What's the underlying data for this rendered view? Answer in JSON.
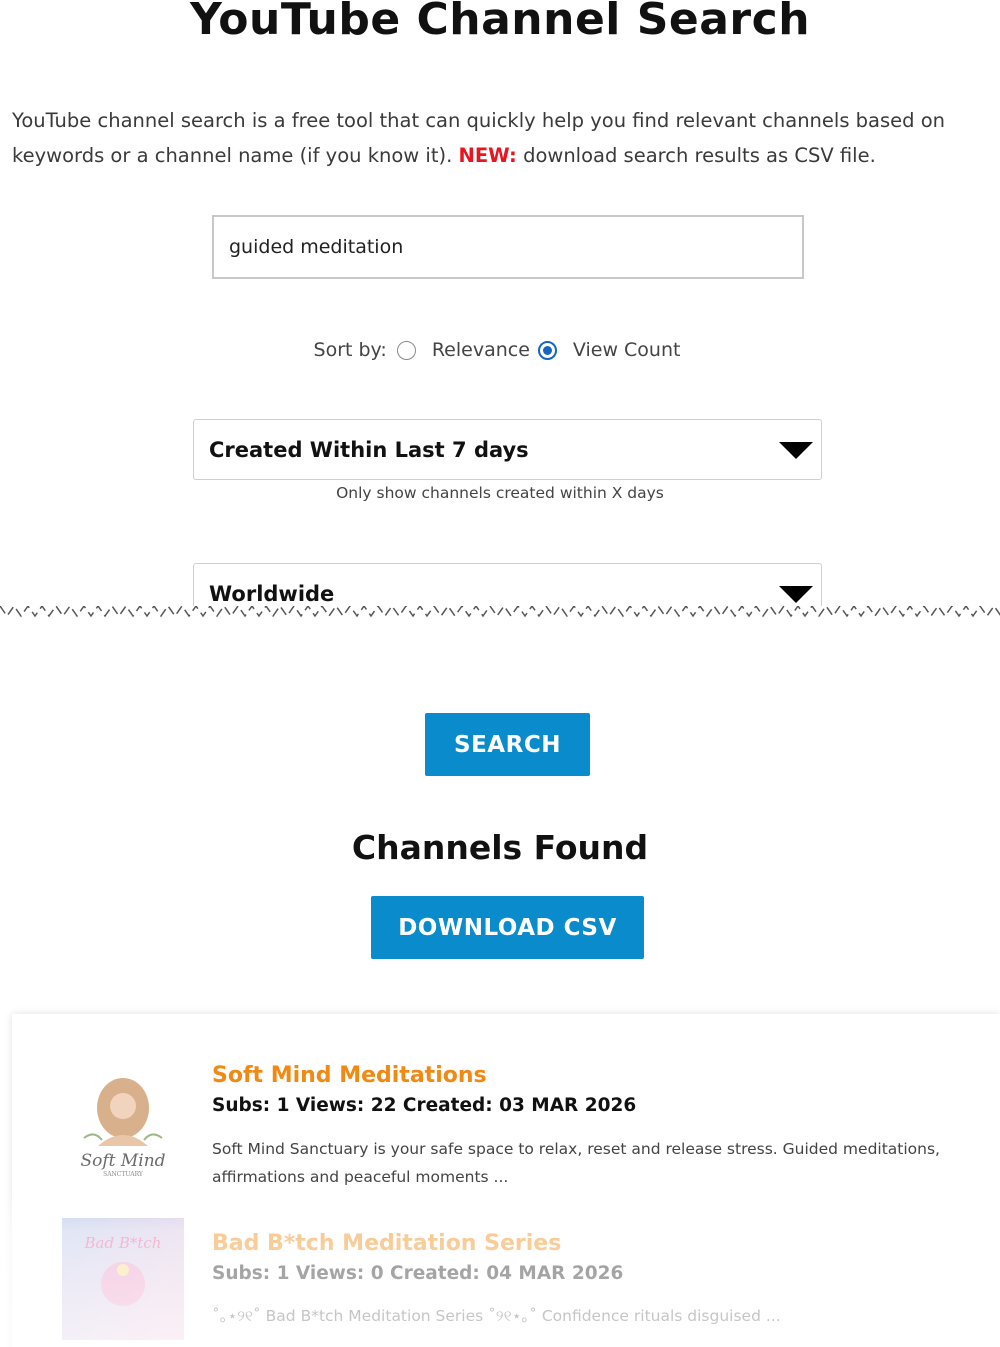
{
  "page": {
    "title": "YouTube Channel Search",
    "intro_text": "YouTube channel search is a free tool that can quickly help you find relevant channels based on keywords or a channel name (if you know it).",
    "intro_new_label": "NEW:",
    "intro_new_text": "download search results as CSV file."
  },
  "search": {
    "value": "guided meditation"
  },
  "sort": {
    "label": "Sort by:",
    "options": [
      {
        "label": "Relevance",
        "checked": false
      },
      {
        "label": "View Count",
        "checked": true
      }
    ]
  },
  "filters": {
    "created_selected": "Created Within Last 7 days",
    "created_hint": "Only show channels created within X days",
    "region_selected": "Worldwide"
  },
  "buttons": {
    "search_label": "SEARCH",
    "download_label": "DOWNLOAD CSV"
  },
  "results": {
    "heading": "Channels Found",
    "items": [
      {
        "title": "Soft Mind Meditations",
        "stats": "Subs: 1 Views: 22 Created: 03 MAR 2026",
        "description": "Soft Mind Sanctuary is your safe space to relax, reset and release stress. Guided meditations, affirmations and peaceful moments ...",
        "thumb_text": "Soft Mind",
        "thumb_subtext": "SANCTUARY"
      },
      {
        "title": "Bad B*tch Meditation Series",
        "stats": "Subs: 1 Views: 0 Created: 04 MAR 2026",
        "description": "˚｡⋆୨୧˚ Bad B*tch Meditation Series ˚୨୧⋆｡˚ Confidence rituals disguised ...",
        "thumb_text": "Bad B*tch"
      }
    ]
  },
  "colors": {
    "accent": "#0a8ccc",
    "new_label": "#e8141e",
    "result_title": "#f08a14",
    "radio_checked": "#1565c0"
  }
}
